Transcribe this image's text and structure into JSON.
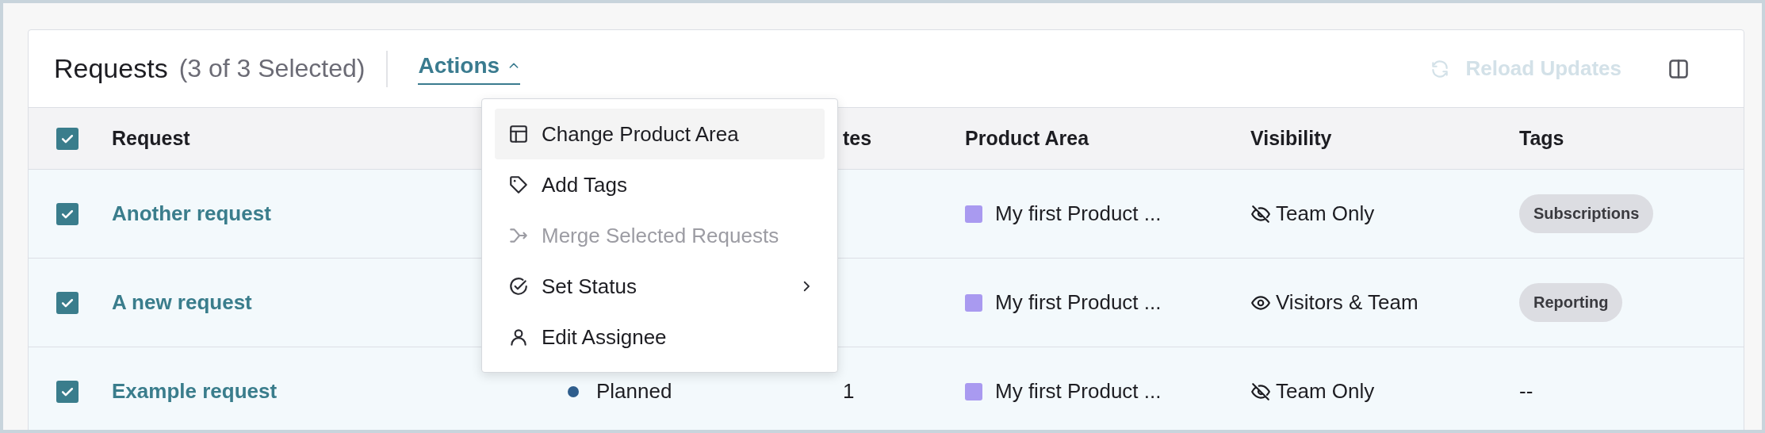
{
  "header": {
    "title": "Requests",
    "selection_count": "(3 of 3 Selected)",
    "actions_button": {
      "label": "Actions",
      "expanded": true
    },
    "reload_button": {
      "label": "Reload Updates",
      "disabled": true
    }
  },
  "actions_menu": [
    {
      "label": "Change Product Area",
      "highlighted": true,
      "disabled": false,
      "submenu": false
    },
    {
      "label": "Add Tags",
      "highlighted": false,
      "disabled": false,
      "submenu": false
    },
    {
      "label": "Merge Selected Requests",
      "highlighted": false,
      "disabled": true,
      "submenu": false
    },
    {
      "label": "Set Status",
      "highlighted": false,
      "disabled": false,
      "submenu": true
    },
    {
      "label": "Edit Assignee",
      "highlighted": false,
      "disabled": false,
      "submenu": false
    }
  ],
  "table": {
    "select_all": {
      "checked": true
    },
    "header": {
      "request": "Request",
      "column_4": "tes",
      "product_area": "Product Area",
      "visibility": "Visibility",
      "tags": "Tags"
    },
    "rows": [
      {
        "checked": true,
        "request": "Another request",
        "product_area": {
          "label": "My first Product ...",
          "color": "#a99af0"
        },
        "visibility": {
          "kind": "team_only",
          "label": "Team Only"
        },
        "tags": [
          "Subscriptions"
        ]
      },
      {
        "checked": true,
        "request": "A new request",
        "product_area": {
          "label": "My first Product ...",
          "color": "#a99af0"
        },
        "visibility": {
          "kind": "visitors_and_team",
          "label": "Visitors & Team"
        },
        "tags": [
          "Reporting"
        ]
      },
      {
        "checked": true,
        "request": "Example request",
        "status": {
          "label": "Planned",
          "color": "#2e5d8c"
        },
        "votes": "1",
        "product_area": {
          "label": "My first Product ...",
          "color": "#a99af0"
        },
        "visibility": {
          "kind": "team_only",
          "label": "Team Only"
        },
        "tags_text": "--"
      }
    ]
  }
}
